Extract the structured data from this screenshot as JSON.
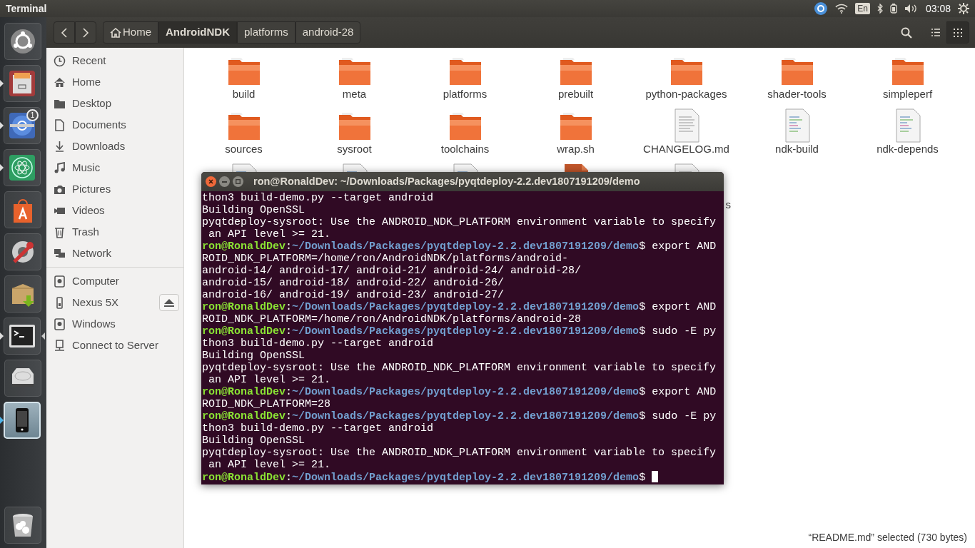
{
  "top_bar": {
    "title": "Terminal",
    "keyboard": "En",
    "clock": "03:08"
  },
  "launcher": [
    {
      "kind": "dash",
      "running": false,
      "focused": false,
      "highlighted": false
    },
    {
      "kind": "files",
      "running": true,
      "focused": false,
      "highlighted": false
    },
    {
      "kind": "browser",
      "running": true,
      "focused": false,
      "highlighted": false,
      "badge": "1"
    },
    {
      "kind": "atom",
      "running": true,
      "focused": false,
      "highlighted": false
    },
    {
      "kind": "store",
      "running": false,
      "focused": false,
      "highlighted": false
    },
    {
      "kind": "settings",
      "running": false,
      "focused": false,
      "highlighted": false
    },
    {
      "kind": "archive",
      "running": false,
      "focused": false,
      "highlighted": false
    },
    {
      "kind": "terminal",
      "running": true,
      "focused": true,
      "highlighted": false
    },
    {
      "kind": "disk",
      "running": false,
      "focused": false,
      "highlighted": false
    },
    {
      "kind": "phone",
      "running": true,
      "focused": false,
      "highlighted": true
    },
    {
      "kind": "trash",
      "running": false,
      "focused": false,
      "highlighted": false
    }
  ],
  "file_manager": {
    "path": [
      {
        "label": "Home",
        "kind": "home",
        "selected": false
      },
      {
        "label": "AndroidNDK",
        "kind": "dir",
        "selected": true
      },
      {
        "label": "platforms",
        "kind": "dir",
        "selected": false
      },
      {
        "label": "android-28",
        "kind": "dir",
        "selected": false
      }
    ],
    "view_buttons": [
      {
        "kind": "list",
        "selected": false
      },
      {
        "kind": "grid",
        "selected": true
      }
    ],
    "sidebar": {
      "places": [
        {
          "label": "Recent",
          "kind": "clock"
        },
        {
          "label": "Home",
          "kind": "home"
        },
        {
          "label": "Desktop",
          "kind": "folder"
        },
        {
          "label": "Documents",
          "kind": "document"
        },
        {
          "label": "Downloads",
          "kind": "download"
        },
        {
          "label": "Music",
          "kind": "music"
        },
        {
          "label": "Pictures",
          "kind": "camera"
        },
        {
          "label": "Videos",
          "kind": "video"
        },
        {
          "label": "Trash",
          "kind": "trash"
        },
        {
          "label": "Network",
          "kind": "network"
        }
      ],
      "devices": [
        {
          "label": "Computer",
          "kind": "drive",
          "ejectable": false
        },
        {
          "label": "Nexus 5X",
          "kind": "phone",
          "ejectable": true
        },
        {
          "label": "Windows",
          "kind": "drive",
          "ejectable": false
        },
        {
          "label": "Connect to Server",
          "kind": "server",
          "ejectable": false
        }
      ]
    },
    "files": [
      {
        "label": "build",
        "kind": "folder"
      },
      {
        "label": "meta",
        "kind": "folder"
      },
      {
        "label": "platforms",
        "kind": "folder"
      },
      {
        "label": "prebuilt",
        "kind": "folder"
      },
      {
        "label": "python-packages",
        "kind": "folder"
      },
      {
        "label": "shader-tools",
        "kind": "folder"
      },
      {
        "label": "simpleperf",
        "kind": "folder"
      },
      {
        "label": "sources",
        "kind": "folder"
      },
      {
        "label": "sysroot",
        "kind": "folder"
      },
      {
        "label": "toolchains",
        "kind": "folder"
      },
      {
        "label": "wrap.sh",
        "kind": "folder"
      },
      {
        "label": "CHANGELOG.md",
        "kind": "document"
      },
      {
        "label": "ndk-build",
        "kind": "script"
      },
      {
        "label": "ndk-depends",
        "kind": "script"
      },
      {
        "kind": "script"
      },
      {
        "kind": "script"
      },
      {
        "kind": "script"
      },
      {
        "kind": "package"
      },
      {
        "kind": "document",
        "label_tail": "s"
      }
    ],
    "status": "“README.md” selected  (730 bytes)"
  },
  "terminal": {
    "title": "ron@RonaldDev: ~/Downloads/Packages/pyqtdeploy-2.2.dev1807191209/demo",
    "cursor": true,
    "lines": [
      [
        {
          "kind": "plain",
          "text": "thon3 build-demo.py --target android"
        }
      ],
      [
        {
          "kind": "plain",
          "text": "Building OpenSSL"
        }
      ],
      [
        {
          "kind": "plain",
          "text": "pyqtdeploy-sysroot: Use the ANDROID_NDK_PLATFORM environment variable to specify"
        }
      ],
      [
        {
          "kind": "plain",
          "text": " an API level >= 21."
        }
      ],
      [
        {
          "kind": "user",
          "text": "ron@RonaldDev"
        },
        {
          "kind": "plain",
          "text": ":"
        },
        {
          "kind": "path",
          "text": "~/Downloads/Packages/pyqtdeploy-2.2.dev1807191209/demo"
        },
        {
          "kind": "plain",
          "text": "$ export AND"
        }
      ],
      [
        {
          "kind": "plain",
          "text": "ROID_NDK_PLATFORM=/home/ron/AndroidNDK/platforms/android-"
        }
      ],
      [
        {
          "kind": "plain",
          "text": "android-14/ android-17/ android-21/ android-24/ android-28/"
        }
      ],
      [
        {
          "kind": "plain",
          "text": "android-15/ android-18/ android-22/ android-26/"
        }
      ],
      [
        {
          "kind": "plain",
          "text": "android-16/ android-19/ android-23/ android-27/"
        }
      ],
      [
        {
          "kind": "user",
          "text": "ron@RonaldDev"
        },
        {
          "kind": "plain",
          "text": ":"
        },
        {
          "kind": "path",
          "text": "~/Downloads/Packages/pyqtdeploy-2.2.dev1807191209/demo"
        },
        {
          "kind": "plain",
          "text": "$ export AND"
        }
      ],
      [
        {
          "kind": "plain",
          "text": "ROID_NDK_PLATFORM=/home/ron/AndroidNDK/platforms/android-28"
        }
      ],
      [
        {
          "kind": "user",
          "text": "ron@RonaldDev"
        },
        {
          "kind": "plain",
          "text": ":"
        },
        {
          "kind": "path",
          "text": "~/Downloads/Packages/pyqtdeploy-2.2.dev1807191209/demo"
        },
        {
          "kind": "plain",
          "text": "$ sudo -E py"
        }
      ],
      [
        {
          "kind": "plain",
          "text": "thon3 build-demo.py --target android"
        }
      ],
      [
        {
          "kind": "plain",
          "text": "Building OpenSSL"
        }
      ],
      [
        {
          "kind": "plain",
          "text": "pyqtdeploy-sysroot: Use the ANDROID_NDK_PLATFORM environment variable to specify"
        }
      ],
      [
        {
          "kind": "plain",
          "text": " an API level >= 21."
        }
      ],
      [
        {
          "kind": "user",
          "text": "ron@RonaldDev"
        },
        {
          "kind": "plain",
          "text": ":"
        },
        {
          "kind": "path",
          "text": "~/Downloads/Packages/pyqtdeploy-2.2.dev1807191209/demo"
        },
        {
          "kind": "plain",
          "text": "$ export AND"
        }
      ],
      [
        {
          "kind": "plain",
          "text": "ROID_NDK_PLATFORM=28"
        }
      ],
      [
        {
          "kind": "user",
          "text": "ron@RonaldDev"
        },
        {
          "kind": "plain",
          "text": ":"
        },
        {
          "kind": "path",
          "text": "~/Downloads/Packages/pyqtdeploy-2.2.dev1807191209/demo"
        },
        {
          "kind": "plain",
          "text": "$ sudo -E py"
        }
      ],
      [
        {
          "kind": "plain",
          "text": "thon3 build-demo.py --target android"
        }
      ],
      [
        {
          "kind": "plain",
          "text": "Building OpenSSL"
        }
      ],
      [
        {
          "kind": "plain",
          "text": "pyqtdeploy-sysroot: Use the ANDROID_NDK_PLATFORM environment variable to specify"
        }
      ],
      [
        {
          "kind": "plain",
          "text": " an API level >= 21."
        }
      ],
      [
        {
          "kind": "user",
          "text": "ron@RonaldDev"
        },
        {
          "kind": "plain",
          "text": ":"
        },
        {
          "kind": "path",
          "text": "~/Downloads/Packages/pyqtdeploy-2.2.dev1807191209/demo"
        },
        {
          "kind": "plain",
          "text": "$ "
        }
      ]
    ]
  }
}
